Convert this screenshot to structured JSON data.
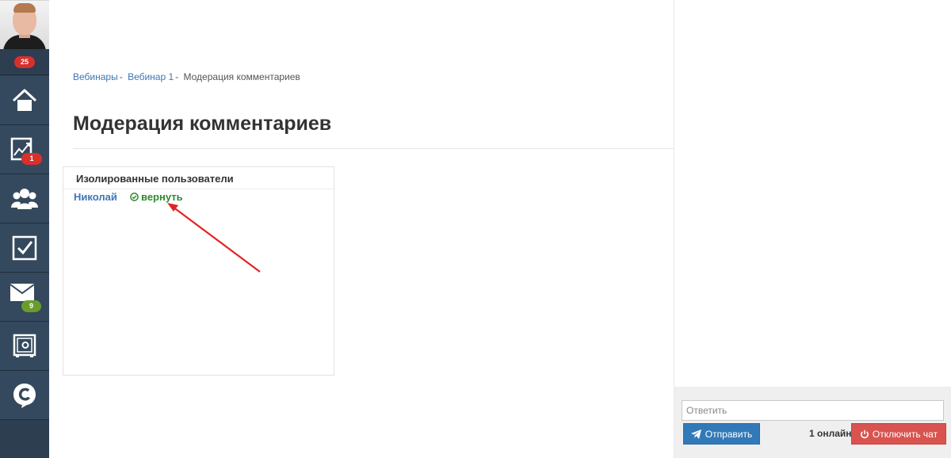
{
  "sidebar": {
    "avatar_alt": "",
    "top_badge": "25",
    "items": [
      {
        "name": "home",
        "icon": "home-icon",
        "badge": ""
      },
      {
        "name": "stats",
        "icon": "chart-growth-icon",
        "badge": "1",
        "badge_color": "#d9302b"
      },
      {
        "name": "users",
        "icon": "users-group-icon",
        "badge": ""
      },
      {
        "name": "tasks",
        "icon": "checkbox-icon",
        "badge": ""
      },
      {
        "name": "messages",
        "icon": "envelope-icon",
        "badge": "9",
        "badge_color": "#6a9c2b"
      },
      {
        "name": "safe",
        "icon": "safe-icon",
        "badge": ""
      },
      {
        "name": "chat",
        "icon": "chat-bubble-c-icon",
        "badge": ""
      }
    ]
  },
  "breadcrumb": {
    "items": [
      {
        "label": "Вебинары",
        "link": true
      },
      {
        "label": "Вебинар 1",
        "link": true
      },
      {
        "label": "Модерация комментариев",
        "link": false
      }
    ],
    "separator": "-"
  },
  "page": {
    "title": "Модерация комментариев"
  },
  "isolated_panel": {
    "title": "Изолированные пользователи",
    "users": [
      {
        "name": "Николай",
        "action_label": "вернуть"
      }
    ]
  },
  "chat": {
    "reply_placeholder": "Ответить",
    "send_label": "Отправить",
    "online_label": "1 онлайн",
    "disconnect_label": "Отключить чат"
  },
  "colors": {
    "sidebar": "#34495e",
    "link": "#3f76b5",
    "restore": "#2e8b2e",
    "send_button": "#3279b8",
    "disconnect_button": "#d9534f",
    "arrow": "#e52222"
  }
}
